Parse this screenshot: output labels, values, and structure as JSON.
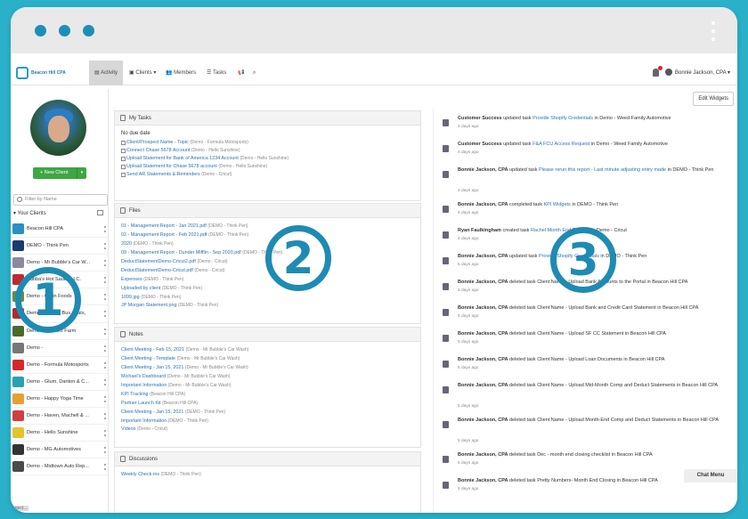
{
  "nav": {
    "logo_text": "Beacon Hill CPA",
    "items": [
      "Activity",
      "Clients",
      "Members",
      "Tasks"
    ],
    "user_name": "Bonnie Jackson, CPA"
  },
  "edit_widgets_label": "Edit Widgets",
  "sidebar": {
    "new_client_label": "New Client",
    "filter_placeholder": "Filter by Name",
    "your_clients_label": "Your Clients",
    "clients": [
      {
        "name": "Beacon Hill CPA",
        "color": "#2a8fc4"
      },
      {
        "name": "DEMO - Think Pen",
        "color": "#1b3a6e"
      },
      {
        "name": "Demo - Mr Bubble's Car W...",
        "color": "#8a8a9a"
      },
      {
        "name": "Bubba's Hot Sauce LLC.",
        "color": "#c0282e"
      },
      {
        "name": "Demo - Grain Foods",
        "color": "#6b8a3a"
      },
      {
        "name": "Demo - Chariot Bus, Plats,",
        "color": "#b02a2a"
      },
      {
        "name": "Demo - Connect Farm",
        "color": "#4a6a2a"
      },
      {
        "name": "Demo - ",
        "color": "#777777"
      },
      {
        "name": "Demo - Formula Motosports",
        "color": "#d8262b"
      },
      {
        "name": "Demo - Glum, Danton & C...",
        "color": "#2aa0b0"
      },
      {
        "name": "Demo - Happy Yoga Time",
        "color": "#e8a030"
      },
      {
        "name": "Demo - Haven, Machell & ...",
        "color": "#d04040"
      },
      {
        "name": "Demo - Hello Sunshine",
        "color": "#e6c230"
      },
      {
        "name": "Demo - MG Automotives",
        "color": "#333333"
      },
      {
        "name": "Demo - Midtown Auto Rep...",
        "color": "#4a4a4a"
      }
    ],
    "status_tag": "nnect..."
  },
  "my_tasks": {
    "title": "My Tasks",
    "no_due": "No due date",
    "items": [
      {
        "title": "Client/Prospect Name - Topic",
        "meta": "(Demo - Formula Motosports)"
      },
      {
        "title": "Connect Chase 5678 Account",
        "meta": "(Demo - Hello Sunshine)"
      },
      {
        "title": "Upload Statement for Bank of America 1234 Account",
        "meta": "(Demo - Hello Sunshine)"
      },
      {
        "title": "Upload Statement for Chase 5678 account",
        "meta": "(Demo - Hello Sunshine)"
      },
      {
        "title": "Send AR Statements & Reminders",
        "meta": "(Demo - Cricut)"
      }
    ]
  },
  "files": {
    "title": "Files",
    "items": [
      {
        "title": "01 - Management Report - Jan 2021.pdf",
        "meta": "(DEMO - Think Pen)"
      },
      {
        "title": "02 - Management Report - Feb 2021.pdf",
        "meta": "(DEMO - Think Pen)"
      },
      {
        "title": "2020",
        "meta": "(DEMO - Think Pen)"
      },
      {
        "title": "09 - Management Report - Dunder Mifflin - Sep 2020.pdf",
        "meta": "(DEMO - Think Pen)"
      },
      {
        "title": "DeductStatementDemo-Cricut2.pdf",
        "meta": "(Demo - Cricut)"
      },
      {
        "title": "DeductStatementDemo-Cricut.pdf",
        "meta": "(Demo - Cricut)"
      },
      {
        "title": "Expenses",
        "meta": "(DEMO - Think Pen)"
      },
      {
        "title": "Uploaded by client",
        "meta": "(DEMO - Think Pen)"
      },
      {
        "title": "1099.jpg",
        "meta": "(DEMO - Think Pen)"
      },
      {
        "title": "JP Morgan Statement.png",
        "meta": "(DEMO - Think Pen)"
      }
    ]
  },
  "notes": {
    "title": "Notes",
    "items": [
      {
        "title": "Client Meeting - Feb 15, 2021",
        "meta": "(Demo - Mr Bubble's Car Wash)"
      },
      {
        "title": "Client Meeting - Template",
        "meta": "(Demo - Mr Bubble's Car Wash)"
      },
      {
        "title": "Client Meeting - Jan 15, 2021",
        "meta": "(Demo - Mr Bubble's Car Wash)"
      },
      {
        "title": "Michael's Dashboard",
        "meta": "(Demo - Mr Bubble's Car Wash)"
      },
      {
        "title": "Important Information",
        "meta": "(Demo - Mr Bubble's Car Wash)"
      },
      {
        "title": "KPI Tracking",
        "meta": "(Beacon Hill CPA)"
      },
      {
        "title": "Partner Launch Kit",
        "meta": "(Beacon Hill CPA)"
      },
      {
        "title": "Client Meeting - Jan 15, 2021",
        "meta": "(DEMO - Think Pen)"
      },
      {
        "title": "Important Information",
        "meta": "(DEMO - Think Pen)"
      },
      {
        "title": "Videos",
        "meta": "(Demo - Cricut)"
      }
    ]
  },
  "discussions": {
    "title": "Discussions",
    "first": {
      "title": "Weekly Check-ins",
      "meta": "(DEMO - Think Pen)"
    }
  },
  "activity": [
    {
      "actor": "Customer Success",
      "verb": "updated task",
      "link": "Provide Shopify Credentials",
      "rest": "in Demo - Weed Family Automotive",
      "days": "4 days ago",
      "tall": false
    },
    {
      "actor": "Customer Success",
      "verb": "updated task",
      "link": "F&A FCU Access Request",
      "rest": "in Demo - Weed Family Automotive",
      "days": "4 days ago",
      "tall": false
    },
    {
      "actor": "Bonnie Jackson, CPA",
      "verb": "updated task",
      "link": "Please rerun this report - Last minute adjusting entry made",
      "rest": "in DEMO - Think Pen",
      "days": "4 days ago",
      "tall": true
    },
    {
      "actor": "Bonnie Jackson, CPA",
      "verb": "completed task",
      "link": "KPI Widgets",
      "rest": "in DEMO - Think Pen",
      "days": "4 days ago",
      "tall": false
    },
    {
      "actor": "Ryan Faulkingham",
      "verb": "created task",
      "link": "Rachel Month End Process",
      "rest": "in Demo - Cricut",
      "days": "4 days ago",
      "tall": false
    },
    {
      "actor": "Bonnie Jackson, CPA",
      "verb": "updated task",
      "link": "Provide Shopify Credentials",
      "rest": "in DEMO - Think Pen",
      "days": "5 days ago",
      "tall": false
    },
    {
      "actor": "Bonnie Jackson, CPA",
      "verb": "deleted task",
      "link": "",
      "rest": "Client Name - Upload Bank Accounts to the Portal in Beacon Hill CPA",
      "days": "5 days ago",
      "tall": false
    },
    {
      "actor": "Bonnie Jackson, CPA",
      "verb": "deleted task",
      "link": "",
      "rest": "Client Name - Upload Bank and Credit Card Statement in Beacon Hill CPA",
      "days": "5 days ago",
      "tall": false
    },
    {
      "actor": "Bonnie Jackson, CPA",
      "verb": "deleted task",
      "link": "",
      "rest": "Client Name - Upload SF CC Statement in Beacon Hill CPA",
      "days": "5 days ago",
      "tall": false
    },
    {
      "actor": "Bonnie Jackson, CPA",
      "verb": "deleted task",
      "link": "",
      "rest": "Client Name - Upload Loan Documents in Beacon Hill CPA",
      "days": "5 days ago",
      "tall": false
    },
    {
      "actor": "Bonnie Jackson, CPA",
      "verb": "deleted task",
      "link": "",
      "rest": "Client Name - Upload Mid-Month Comp and Deduct Statements in Beacon Hill CPA",
      "days": "5 days ago",
      "tall": true
    },
    {
      "actor": "Bonnie Jackson, CPA",
      "verb": "deleted task",
      "link": "",
      "rest": "Client Name - Upload Month-End Comp and Deduct Statements in Beacon Hill CPA",
      "days": "5 days ago",
      "tall": true
    },
    {
      "actor": "Bonnie Jackson, CPA",
      "verb": "deleted task",
      "link": "",
      "rest": "Dec - month end closing checklist in Beacon Hill CPA",
      "days": "5 days ago",
      "tall": false
    },
    {
      "actor": "Bonnie Jackson, CPA",
      "verb": "deleted task",
      "link": "",
      "rest": "Pretty Numbers- Month End Closing in Beacon Hill CPA",
      "days": "5 days ago",
      "tall": false
    }
  ],
  "chat_menu_label": "Chat Menu",
  "callouts": [
    "1",
    "2",
    "3"
  ],
  "colors": {
    "background": "#2ab0c9",
    "accent": "#1e8bb3",
    "new_client_button": "#3ea742"
  }
}
